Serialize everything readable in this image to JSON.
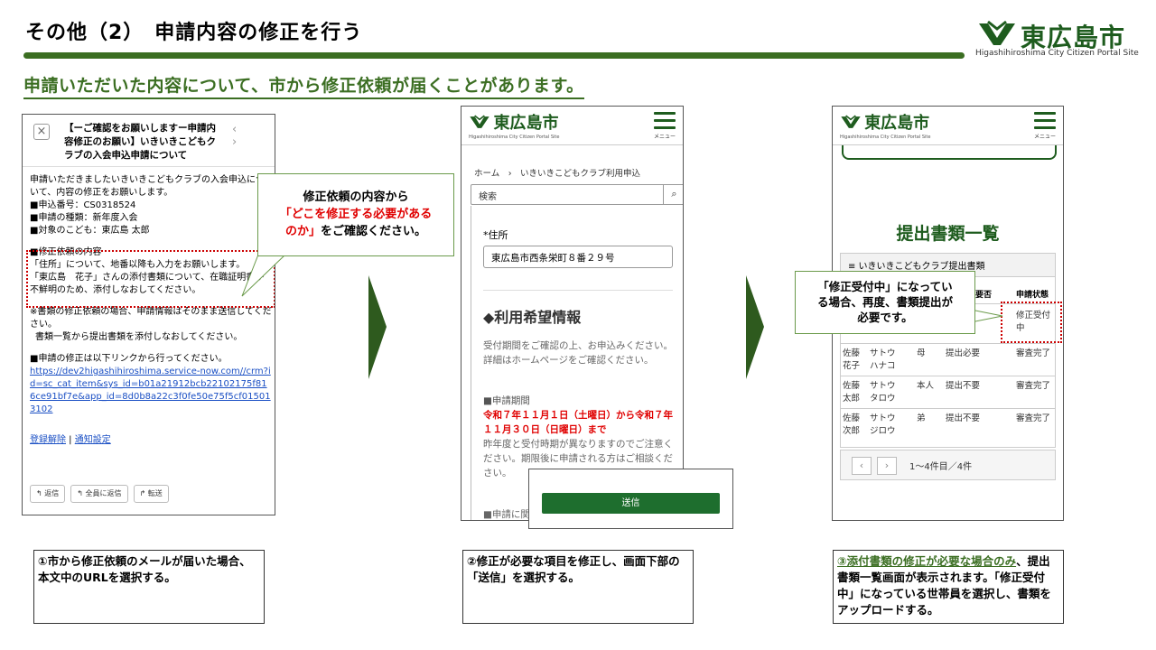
{
  "header": {
    "title": "その他（2）　申請内容の修正を行う",
    "logo_text": "東広島市",
    "logo_sub": "Higashihiroshima City Citizen Portal Site",
    "subtitle": "申請いただいた内容について、市から修正依頼が届くことがあります。"
  },
  "email": {
    "subject": "【ーご確認をお願いしますー申請内容修正のお願い】いきいきこどもクラブの入会申込申請について",
    "nav": "‹ ›",
    "intro": "申請いただきましたいきいきこどもクラブの入会申込について、内容の修正をお願いします。",
    "app_no": "■申込番号：CS0318524",
    "app_type": "■申請の種類：新年度入会",
    "child": "■対象のこども：東広島 太郎",
    "req_title": "■修正依頼の内容",
    "req_1": "「住所」について、地番以降も入力をお願いします。",
    "req_2": "「東広島　花子」さんの添付書類について、在職証明書が不鮮明のため、添付しなおしてください。",
    "note_1": "※書類の修正依頼の場合、申請情報はそのまま送信してください。",
    "note_2": "書類一覧から提出書類を添付しなおしてください。",
    "link_intro": "■申請の修正は以下リンクから行ってください。",
    "link": "https://dev2higashihiroshima.service-now.com//crm?id=sc_cat_item&sys_id=b01a21912bcb22102175f816ce91bf7e&app_id=8d0b8a22c3f0fe50e75f5cf015013102",
    "unsub": "登録解除",
    "notify": "通知設定",
    "sep": " | ",
    "btn_reply": "返信",
    "btn_reply_all": "全員に返信",
    "btn_forward": "転送"
  },
  "callout1": {
    "line1": "修正依頼の内容から",
    "line2": "「どこを修正する必要がある",
    "line3": "のか」",
    "line3_rest": "をご確認ください。"
  },
  "form": {
    "logo_text": "東広島市",
    "logo_sub": "Higashihiroshima City Citizen Portal Site",
    "menu": "メニュー",
    "breadcrumb": "ホーム　›　いきいきこどもクラブ利用申込",
    "search_placeholder": "検索",
    "address_label": "*住所",
    "address_value": "東広島市西条栄町８番２９号",
    "section": "◆利用希望情報",
    "text": "受付期間をご確認の上、お申込みください。詳細はホームページをご確認ください。",
    "period_label": "■申請期間",
    "period": "令和７年１１月１日（土曜日）から令和７年１１月３０日（日曜日）まで",
    "note": "昨年度と受付時期が異なりますのでご注意ください。期限後に申請される方はご相談ください。",
    "more": "■申請に関",
    "send": "送信"
  },
  "docs": {
    "logo_text": "東広島市",
    "logo_sub": "Higashihiroshima City Citizen Portal Site",
    "menu": "メニュー",
    "title": "提出書類一覧",
    "table_title": "≡ いきいきこどもクラブ提出書類",
    "col_need": "の要否",
    "col_status": "申請状態",
    "rows": [
      {
        "name": "",
        "kana": "",
        "rel": "",
        "need": "",
        "status": "修正受付中"
      },
      {
        "name": "佐藤花子",
        "kana": "サトウハナコ",
        "rel": "母",
        "need": "提出必要",
        "status": "審査完了"
      },
      {
        "name": "佐藤太郎",
        "kana": "サトウタロウ",
        "rel": "本人",
        "need": "提出不要",
        "status": "審査完了"
      },
      {
        "name": "佐藤次郎",
        "kana": "サトウジロウ",
        "rel": "弟",
        "need": "提出不要",
        "status": "審査完了"
      }
    ],
    "pager_prev": "‹",
    "pager_next": "›",
    "count": "1〜4件目／4件"
  },
  "callout3": {
    "line1": "「修正受付中」になってい",
    "line2": "る場合、再度、書類提出が",
    "line3": "必要です。"
  },
  "captions": {
    "c1": "①市から修正依頼のメールが届いた場合、本文中のURLを選択する。",
    "c2": "②修正が必要な項目を修正し、画面下部の「送信」を選択する。",
    "c3_u": "③添付書類の修正が必要な場合のみ",
    "c3_rest": "、提出書類一覧画面が表示されます。「修正受付中」になっている世帯員を選択し、書類をアップロードする。"
  },
  "colors": {
    "brand_green": "#1e5c1e",
    "accent_green": "#3b6e22",
    "alert_red": "#e00000"
  }
}
